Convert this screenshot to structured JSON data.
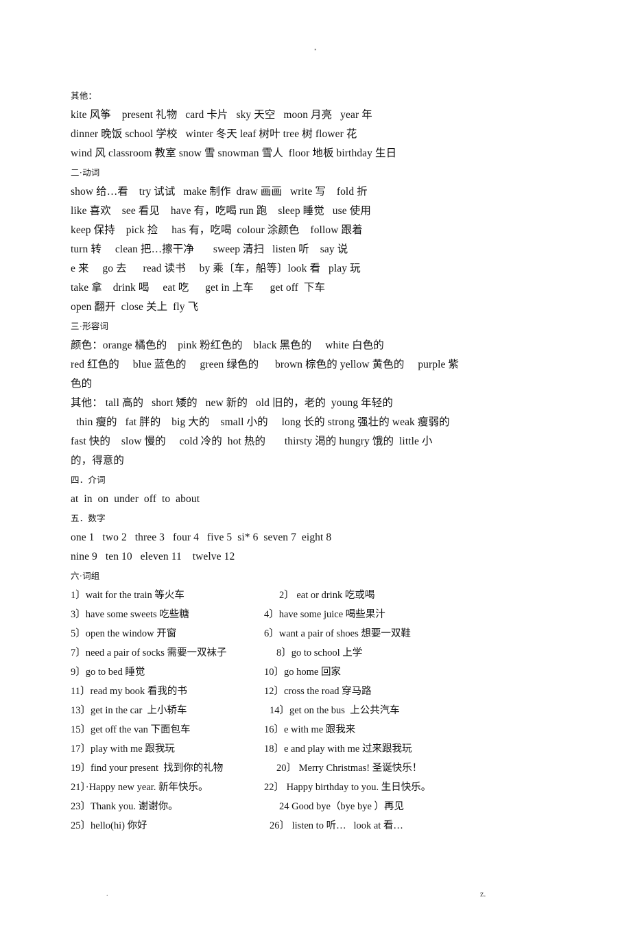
{
  "page": {
    "running_head_mark": "▪",
    "footer_left_mark": ".",
    "footer_right_mark": "z."
  },
  "sections": {
    "nouns_other": {
      "heading": "其他：",
      "lines": [
        "kite 风筝    present 礼物   card 卡片   sky 天空   moon 月亮   year 年",
        "dinner 晚饭 school 学校   winter 冬天 leaf 树叶 tree 树 flower 花",
        "wind 风 classroom 教室 snow 雪 snowman 雪人  floor 地板 birthday 生日"
      ]
    },
    "verbs": {
      "heading": "二·动词",
      "lines": [
        "show 给…看    try 试试   make 制作  draw 画画   write 写    fold 折",
        "like 喜欢    see 看见    have 有，吃喝 run 跑    sleep 睡觉   use 使用",
        "keep 保持    pick 捡     has 有，吃喝  colour 涂颜色    follow 跟着",
        "turn 转     clean 把…擦干净       sweep 清扫   listen 听    say 说",
        "e 来     go 去      read 读书     by 乘〔车，船等〕look 看   play 玩",
        "take 拿    drink 喝     eat 吃      get in 上车      get off  下车",
        "open 翻开  close 关上  fly 飞"
      ]
    },
    "adjectives": {
      "heading": "三·形容词",
      "colors_lines": [
        "颜色：orange 橘色的    pink 粉红色的    black 黑色的     white 白色的",
        "red 红色的     blue 蓝色的     green 绿色的      brown 棕色的 yellow 黄色的     purple 紫",
        "色的"
      ],
      "others_lines": [
        "其他： tall 高的   short 矮的   new 新的   old 旧的，老的  young 年轻的",
        "  thin 瘦的   fat 胖的    big 大的    small 小的     long 长的 strong 强壮的 weak 瘦弱的",
        "fast 快的    slow 慢的     cold 冷的  hot 热的       thirsty 渴的 hungry 饿的  little 小",
        "的，得意的"
      ]
    },
    "prepositions": {
      "heading": "四．介词",
      "lines": [
        "at  in  on  under  off  to  about"
      ]
    },
    "numbers": {
      "heading": "五．数字",
      "lines": [
        "one 1   two 2   three 3   four 4   five 5  si* 6  seven 7  eight 8",
        "nine 9   ten 10   eleven 11    twelve 12"
      ]
    },
    "phrases": {
      "heading": "六·词组",
      "rows": [
        {
          "left": "1〕wait for the train 等火车",
          "right": "2〕 eat or drink 吃或喝",
          "right_indent": "ind-1"
        },
        {
          "left": "3〕have some sweets 吃些糖",
          "right": "4〕have some juice 喝些果汁",
          "right_indent": ""
        },
        {
          "left": "5〕open the window 开窗",
          "right": "6〕want a pair of shoes 想要一双鞋",
          "right_indent": ""
        },
        {
          "left": "7〕need a pair of socks 需要一双袜子",
          "right": "8〕go to school 上学",
          "right_indent": "",
          "wide": true
        },
        {
          "left": "9〕go to bed 睡觉",
          "right": "10〕go home 回家",
          "right_indent": ""
        },
        {
          "left": "11〕read my book 看我的书",
          "right": "12〕cross the road 穿马路",
          "right_indent": ""
        },
        {
          "left": "13〕get in the car  上小轿车",
          "right": "14〕get on the bus  上公共汽车",
          "right_indent": "ind-2"
        },
        {
          "left": "15〕get off the van 下面包车",
          "right": "16〕e with me 跟我来",
          "right_indent": ""
        },
        {
          "left": "17〕play with me 跟我玩",
          "right": "18〕e and play with me 过来跟我玩",
          "right_indent": ""
        },
        {
          "left": "19〕find your present  找到你的礼物",
          "right": "20〕 Merry Christmas! 圣诞快乐！",
          "right_indent": "",
          "wide": true
        },
        {
          "left": "21〕·Happy new year. 新年快乐。",
          "right": "22〕 Happy birthday to you. 生日快乐。",
          "right_indent": ""
        },
        {
          "left": "23〕Thank you. 谢谢你。",
          "right": "24 Good bye（bye bye ）再见",
          "right_indent": "ind-1"
        },
        {
          "left": "25〕hello(hi) 你好",
          "right": "26〕 listen to 听…   look at 看…",
          "right_indent": "ind-2"
        }
      ]
    }
  }
}
